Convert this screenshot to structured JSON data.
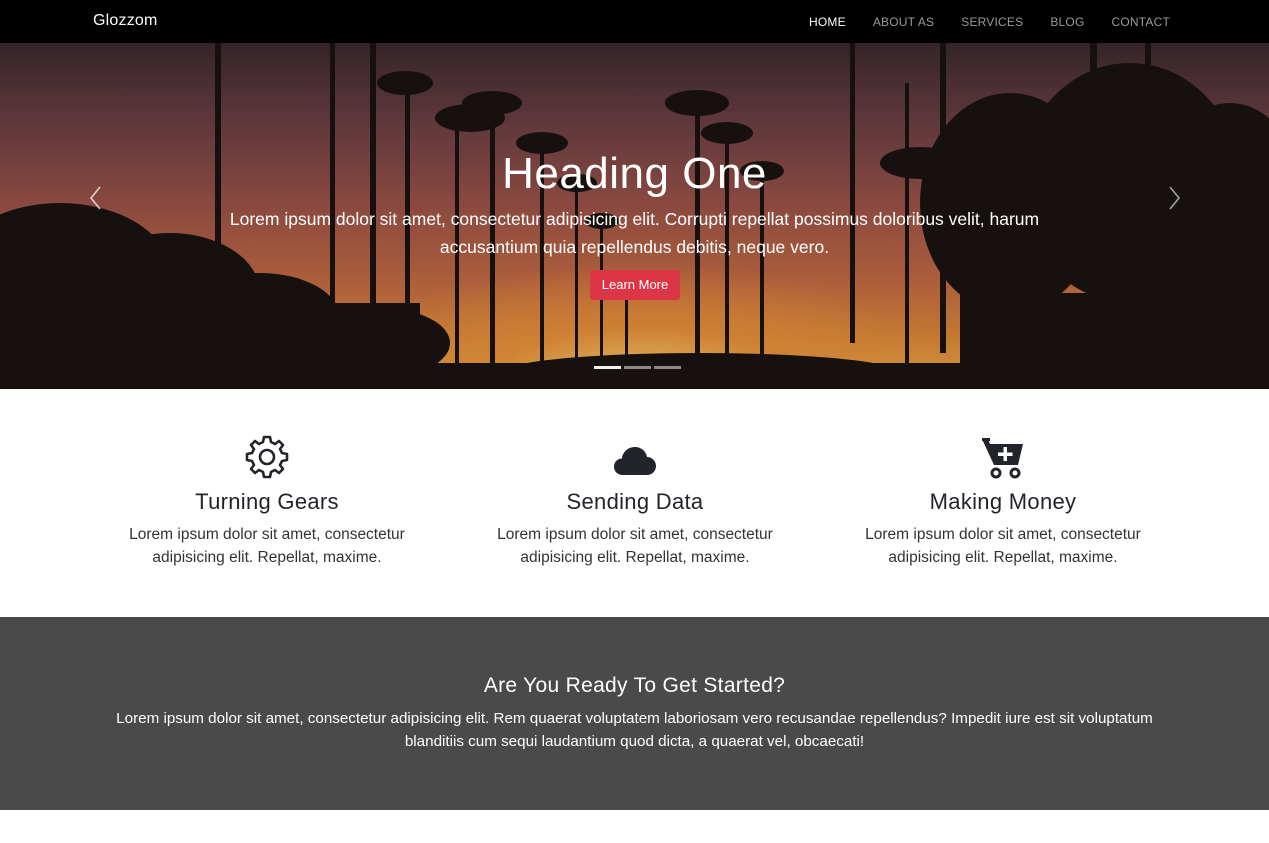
{
  "navbar": {
    "brand": "Glozzom",
    "links": [
      {
        "label": "HOME",
        "active": true
      },
      {
        "label": "ABOUT AS",
        "active": false
      },
      {
        "label": "SERVICES",
        "active": false
      },
      {
        "label": "BLOG",
        "active": false
      },
      {
        "label": "CONTACT",
        "active": false
      }
    ]
  },
  "hero": {
    "title": "Heading One",
    "text": "Lorem ipsum dolor sit amet, consectetur adipisicing elit. Corrupti repellat possimus doloribus velit, harum accusantium quia repellendus debitis, neque vero.",
    "button_label": "Learn More",
    "button_color": "#dc3545",
    "indicator_count": 3,
    "active_indicator": 1
  },
  "features": [
    {
      "icon": "gear-icon",
      "title": "Turning Gears",
      "text": "Lorem ipsum dolor sit amet, consectetur adipisicing elit. Repellat, maxime."
    },
    {
      "icon": "cloud-icon",
      "title": "Sending Data",
      "text": "Lorem ipsum dolor sit amet, consectetur adipisicing elit. Repellat, maxime."
    },
    {
      "icon": "cart-plus-icon",
      "title": "Making Money",
      "text": "Lorem ipsum dolor sit amet, consectetur adipisicing elit. Repellat, maxime."
    }
  ],
  "cta": {
    "title": "Are You Ready To Get Started?",
    "text": "Lorem ipsum dolor sit amet, consectetur adipisicing elit. Rem quaerat voluptatem laboriosam vero recusandae repellendus? Impedit iure est sit voluptatum blanditiis cum sequi laudantium quod dicta, a quaerat vel, obcaecati!",
    "background": "#4a4a4a"
  }
}
